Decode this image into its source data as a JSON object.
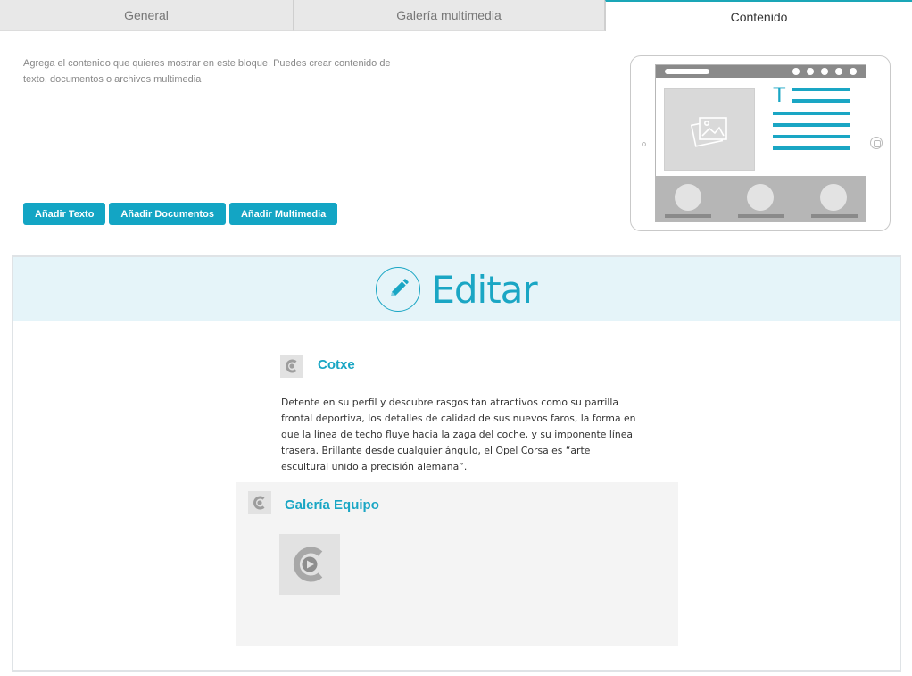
{
  "tabs": [
    {
      "label": "General",
      "active": false
    },
    {
      "label": "Galería multimedia",
      "active": false
    },
    {
      "label": "Contenido",
      "active": true
    }
  ],
  "intro_text": "Agrega el contenido que quieres mostrar en este bloque. Puedes crear contenido de texto, documentos o archivos multimedia",
  "actions": {
    "add_text": "Añadir Texto",
    "add_documents": "Añadir Documentos",
    "add_multimedia": "Añadir Multimedia"
  },
  "editor": {
    "title": "Editar",
    "blocks": [
      {
        "type": "text",
        "icon": "c-logo-icon",
        "title": "Cotxe",
        "body": "Detente en su perfil y descubre rasgos tan atractivos como su parrilla frontal deportiva, los detalles de calidad de sus nuevos faros, la forma en que la línea de techo fluye hacia la zaga del coche, y su imponente línea trasera. Brillante desde cualquier ángulo, el Opel Corsa es “arte escultural unido a precisión alemana”."
      },
      {
        "type": "gallery",
        "icon": "c-logo-icon",
        "title": "Galería Equipo",
        "items": [
          {
            "icon": "video-play-icon"
          }
        ]
      }
    ]
  },
  "colors": {
    "accent": "#1aa6c4",
    "button": "#13a5c4",
    "edit_header_bg": "#e5f4f9",
    "gallery_bg": "#f4f4f4"
  }
}
